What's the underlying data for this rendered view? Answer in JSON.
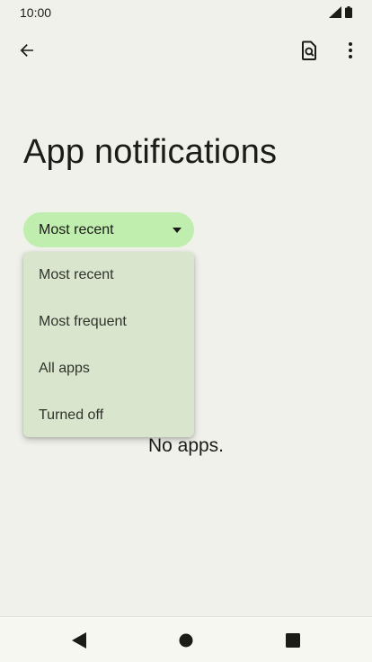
{
  "status_bar": {
    "time": "10:00",
    "icons": [
      "signal-icon",
      "battery-icon"
    ]
  },
  "app_bar": {
    "icons": [
      "arrow-back-icon",
      "search-document-icon",
      "more-vert-icon"
    ]
  },
  "page": {
    "title": "App notifications",
    "empty_message": "No apps."
  },
  "filter": {
    "selected": "Most recent",
    "options": [
      "Most recent",
      "Most frequent",
      "All apps",
      "Turned off"
    ]
  },
  "nav_bar": {
    "icons": [
      "nav-back-icon",
      "nav-home-icon",
      "nav-recents-icon"
    ]
  },
  "colors": {
    "background": "#f1f1ec",
    "chip": "#bfeeaf",
    "menu": "#d9e5cc",
    "text": "#1b1c18"
  }
}
